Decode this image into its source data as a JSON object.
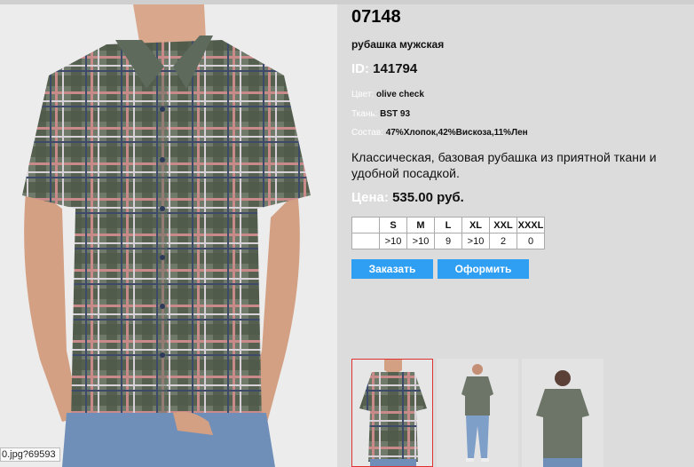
{
  "product": {
    "sku": "07148",
    "subtitle": "рубашка мужская",
    "id_label": "ID:",
    "id_value": "141794",
    "color_label": "Цвет:",
    "color_value": "olive check",
    "fabric_label": "Ткань:",
    "fabric_value": "BST 93",
    "composition_label": "Состав:",
    "composition_value": "47%Хлопок,42%Вискоза,11%Лен",
    "description": "Классическая, базовая рубашка из приятной ткани и удобной посадкой.",
    "price_label": "Цена:",
    "price_value": "535.00 руб."
  },
  "sizes": {
    "headers": [
      "",
      "S",
      "M",
      "L",
      "XL",
      "XXL",
      "XXXL"
    ],
    "stock": [
      "",
      ">10",
      ">10",
      "9",
      ">10",
      "2",
      "0"
    ]
  },
  "buttons": {
    "order": "Заказать",
    "checkout": "Оформить"
  },
  "status_text": "0.jpg?69593",
  "colors": {
    "accent": "#2f9ff3",
    "selected_border": "#e03030",
    "background": "#dcdcdc"
  }
}
